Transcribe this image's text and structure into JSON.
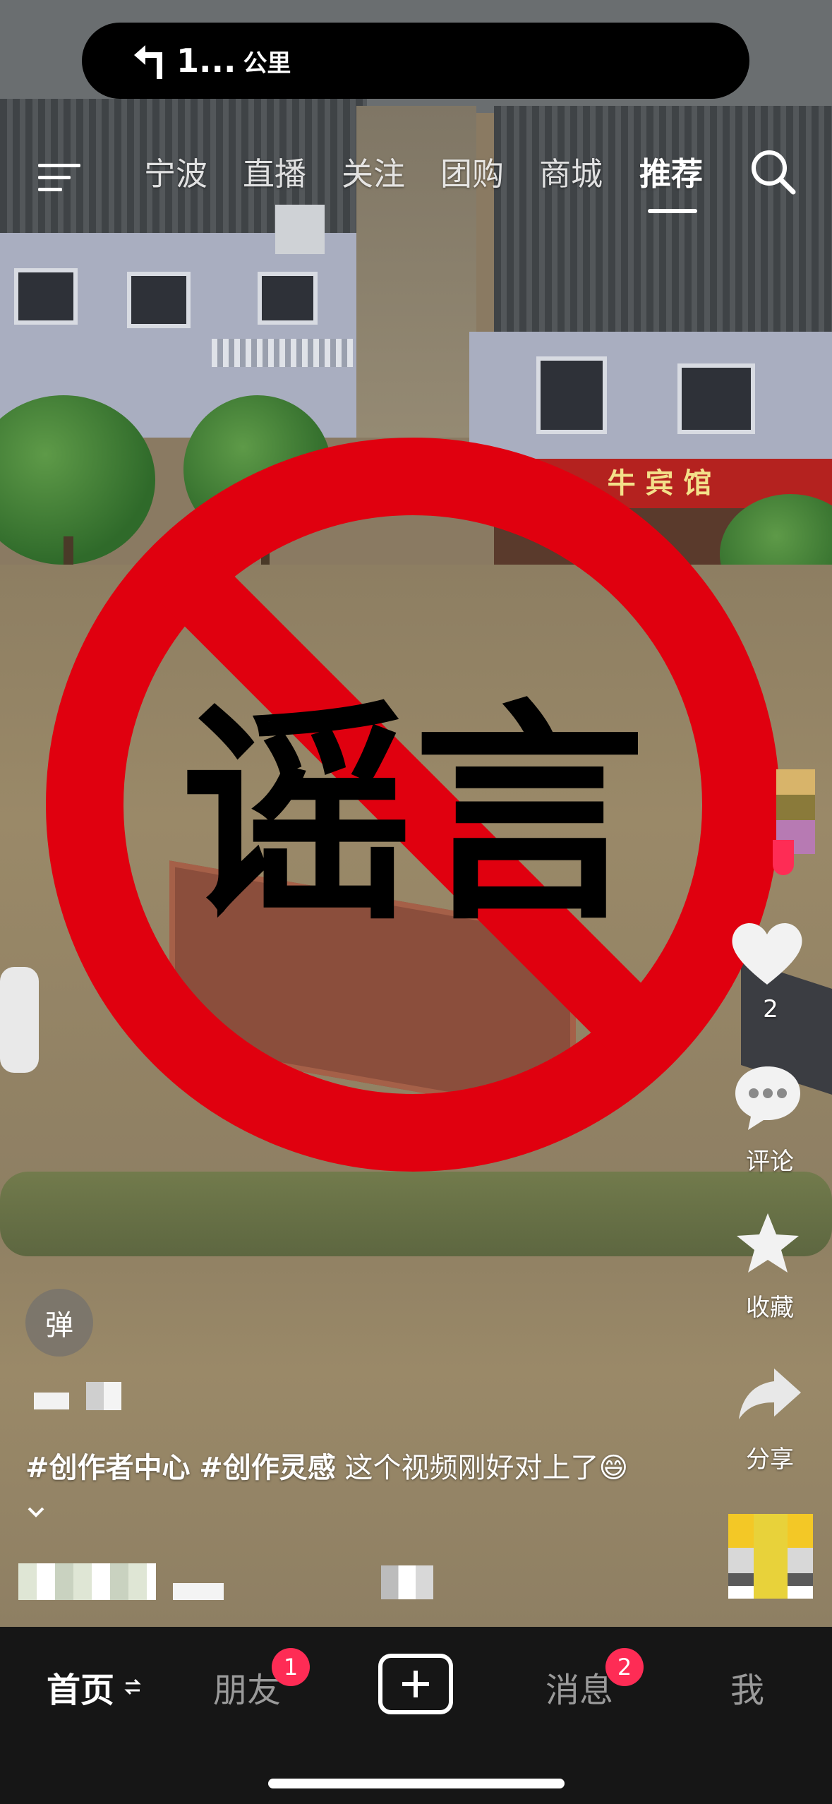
{
  "nav_banner": {
    "distance": "1...",
    "unit": "公里"
  },
  "top_tabs": [
    {
      "label": "宁波"
    },
    {
      "label": "直播"
    },
    {
      "label": "关注"
    },
    {
      "label": "团购"
    },
    {
      "label": "商城"
    },
    {
      "label": "推荐"
    }
  ],
  "active_tab": "推荐",
  "video": {
    "shop_sign": "牛 宾 馆",
    "overlay_text": "谣言"
  },
  "right_rail": {
    "like_count": "2",
    "comment_label": "评论",
    "favorite_label": "收藏",
    "share_label": "分享"
  },
  "danmaku": {
    "label": "弹"
  },
  "caption": {
    "tag1": "#创作者中心",
    "tag2": "#创作灵感",
    "text": " 这个视频刚好对上了",
    "emoji": "😄"
  },
  "bottom_nav": {
    "home": "首页",
    "friends": "朋友",
    "friends_badge": "1",
    "messages": "消息",
    "messages_badge": "2",
    "me": "我"
  },
  "colors": {
    "sign_red": "#e0000f",
    "badge": "#fe2c55",
    "bottom_bar": "#161616"
  }
}
